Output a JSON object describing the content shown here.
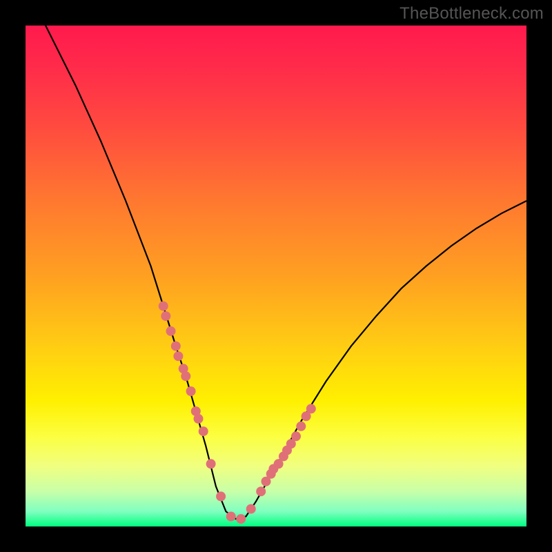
{
  "attribution": "TheBottleneck.com",
  "colors": {
    "curve": "#000000",
    "marker": "#e07078"
  },
  "chart_data": {
    "type": "line",
    "title": "",
    "xlabel": "",
    "ylabel": "",
    "xlim": [
      0,
      100
    ],
    "ylim": [
      0,
      100
    ],
    "grid": false,
    "series": [
      {
        "name": "bottleneck-curve",
        "x": [
          0,
          5,
          10,
          15,
          20,
          25,
          30,
          32,
          34,
          36,
          38,
          40,
          42,
          44,
          46,
          50,
          55,
          60,
          65,
          70,
          75,
          80,
          85,
          90,
          95,
          100
        ],
        "values": [
          108,
          98,
          88,
          77,
          65,
          52,
          36,
          30,
          23,
          16,
          8,
          3,
          1.5,
          2,
          5,
          12,
          21,
          29,
          36,
          42,
          47.5,
          52,
          56,
          59.5,
          62.5,
          65
        ]
      }
    ],
    "markers": {
      "name": "highlighted-points",
      "x": [
        27.5,
        28,
        29,
        30,
        30.5,
        31.5,
        32,
        33,
        34,
        34.5,
        35.5,
        37,
        39,
        41,
        43,
        45,
        47,
        48,
        49,
        49.5,
        50.5,
        51.5,
        52.2,
        53,
        54,
        55,
        56,
        57
      ],
      "values": [
        44,
        42,
        39,
        36,
        34,
        31.5,
        30,
        27,
        23,
        21.5,
        19,
        12.5,
        6,
        2,
        1.5,
        3.5,
        7,
        9,
        10.5,
        11.5,
        12.5,
        14,
        15.2,
        16.5,
        18,
        20,
        22,
        23.5
      ]
    }
  }
}
